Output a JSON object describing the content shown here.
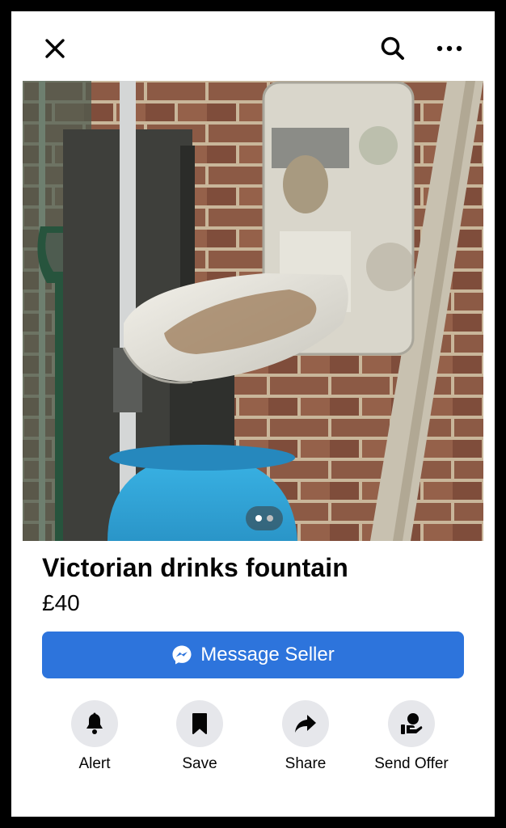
{
  "header": {
    "close_icon": "close-icon",
    "search_icon": "search-icon",
    "more_icon": "more-icon"
  },
  "listing": {
    "title": "Victorian drinks fountain",
    "price": "£40",
    "photo_count": 2,
    "active_photo_index": 0
  },
  "primary_action": {
    "label": "Message Seller",
    "icon": "messenger-icon",
    "color": "#2d74dc"
  },
  "actions": [
    {
      "label": "Alert",
      "icon": "bell-icon"
    },
    {
      "label": "Save",
      "icon": "bookmark-icon"
    },
    {
      "label": "Share",
      "icon": "share-arrow-icon"
    },
    {
      "label": "Send Offer",
      "icon": "offer-hand-icon"
    }
  ]
}
